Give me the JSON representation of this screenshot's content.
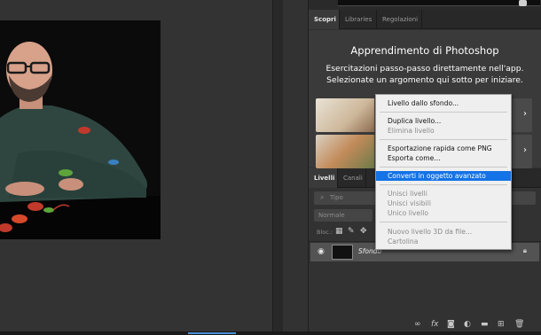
{
  "top_tabs": [
    "Scopri",
    "Libraries",
    "Regolazioni"
  ],
  "learn": {
    "title": "Apprendimento di Photoshop",
    "description": "Esercitazioni passo-passo direttamente nell'app. Selezionate un argomento qui sotto per iniziare."
  },
  "layer_tabs": [
    "Livelli",
    "Canali"
  ],
  "layers": {
    "search_placeholder": "Tipo",
    "blend_mode": "Normale",
    "lock_label": "Bloc.:",
    "layer_name": "Sfondo"
  },
  "context_menu": {
    "items": [
      {
        "label": "Livello dallo sfondo...",
        "disabled": false,
        "highlighted": false
      },
      {
        "label": "Duplica livello...",
        "disabled": false,
        "highlighted": false
      },
      {
        "label": "Elimina livello",
        "disabled": true,
        "highlighted": false
      },
      {
        "label": "Esportazione rapida come PNG",
        "disabled": false,
        "highlighted": false
      },
      {
        "label": "Esporta come...",
        "disabled": false,
        "highlighted": false
      },
      {
        "label": "Converti in oggetto avanzato",
        "disabled": false,
        "highlighted": true
      },
      {
        "label": "Unisci livelli",
        "disabled": true,
        "highlighted": false
      },
      {
        "label": "Unisci visibili",
        "disabled": true,
        "highlighted": false
      },
      {
        "label": "Unico livello",
        "disabled": true,
        "highlighted": false
      },
      {
        "label": "Nuovo livello 3D da file...",
        "disabled": true,
        "highlighted": false
      },
      {
        "label": "Cartolina",
        "disabled": true,
        "highlighted": false
      }
    ]
  },
  "colors": {
    "highlight": "#1473e6",
    "panel_bg": "#323232",
    "menu_bg": "#efefef"
  }
}
